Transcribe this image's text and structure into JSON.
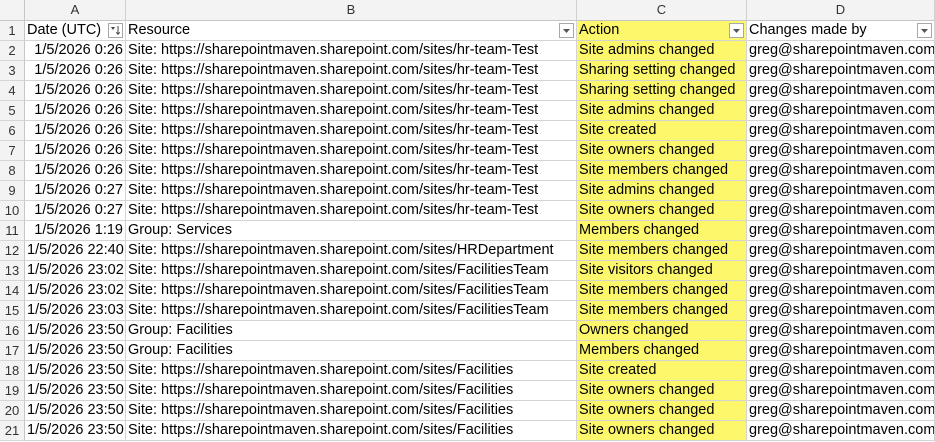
{
  "colors": {
    "highlight": "#fdf86b",
    "header_bg": "#f3f3f3",
    "grid": "#d4d4d4"
  },
  "columns": [
    "A",
    "B",
    "C",
    "D"
  ],
  "header": {
    "date": "Date (UTC)",
    "resource": "Resource",
    "action": "Action",
    "changed_by": "Changes made by"
  },
  "row_numbers": [
    "1",
    "2",
    "3",
    "4",
    "5",
    "6",
    "7",
    "8",
    "9",
    "10",
    "11",
    "12",
    "13",
    "14",
    "15",
    "16",
    "17",
    "18",
    "19",
    "20",
    "21"
  ],
  "rows": [
    {
      "date": "1/5/2026 0:26",
      "resource": "Site: https://sharepointmaven.sharepoint.com/sites/hr-team-Test",
      "action": "Site admins changed",
      "by": "greg@sharepointmaven.com"
    },
    {
      "date": "1/5/2026 0:26",
      "resource": "Site: https://sharepointmaven.sharepoint.com/sites/hr-team-Test",
      "action": "Sharing setting changed",
      "by": "greg@sharepointmaven.com"
    },
    {
      "date": "1/5/2026 0:26",
      "resource": "Site: https://sharepointmaven.sharepoint.com/sites/hr-team-Test",
      "action": "Sharing setting changed",
      "by": "greg@sharepointmaven.com"
    },
    {
      "date": "1/5/2026 0:26",
      "resource": "Site: https://sharepointmaven.sharepoint.com/sites/hr-team-Test",
      "action": "Site admins changed",
      "by": "greg@sharepointmaven.com"
    },
    {
      "date": "1/5/2026 0:26",
      "resource": "Site: https://sharepointmaven.sharepoint.com/sites/hr-team-Test",
      "action": "Site created",
      "by": "greg@sharepointmaven.com"
    },
    {
      "date": "1/5/2026 0:26",
      "resource": "Site: https://sharepointmaven.sharepoint.com/sites/hr-team-Test",
      "action": "Site owners changed",
      "by": "greg@sharepointmaven.com"
    },
    {
      "date": "1/5/2026 0:26",
      "resource": "Site: https://sharepointmaven.sharepoint.com/sites/hr-team-Test",
      "action": "Site members changed",
      "by": "greg@sharepointmaven.com"
    },
    {
      "date": "1/5/2026 0:27",
      "resource": "Site: https://sharepointmaven.sharepoint.com/sites/hr-team-Test",
      "action": "Site admins changed",
      "by": "greg@sharepointmaven.com"
    },
    {
      "date": "1/5/2026 0:27",
      "resource": "Site: https://sharepointmaven.sharepoint.com/sites/hr-team-Test",
      "action": "Site owners changed",
      "by": "greg@sharepointmaven.com"
    },
    {
      "date": "1/5/2026 1:19",
      "resource": "Group: Services",
      "action": "Members changed",
      "by": "greg@sharepointmaven.com"
    },
    {
      "date": "1/5/2026 22:40",
      "resource": "Site: https://sharepointmaven.sharepoint.com/sites/HRDepartment",
      "action": "Site members changed",
      "by": "greg@sharepointmaven.com"
    },
    {
      "date": "1/5/2026 23:02",
      "resource": "Site: https://sharepointmaven.sharepoint.com/sites/FacilitiesTeam",
      "action": "Site visitors changed",
      "by": "greg@sharepointmaven.com"
    },
    {
      "date": "1/5/2026 23:02",
      "resource": "Site: https://sharepointmaven.sharepoint.com/sites/FacilitiesTeam",
      "action": "Site members changed",
      "by": "greg@sharepointmaven.com"
    },
    {
      "date": "1/5/2026 23:03",
      "resource": "Site: https://sharepointmaven.sharepoint.com/sites/FacilitiesTeam",
      "action": "Site members changed",
      "by": "greg@sharepointmaven.com"
    },
    {
      "date": "1/5/2026 23:50",
      "resource": "Group: Facilities",
      "action": "Owners changed",
      "by": "greg@sharepointmaven.com"
    },
    {
      "date": "1/5/2026 23:50",
      "resource": "Group: Facilities",
      "action": "Members changed",
      "by": "greg@sharepointmaven.com"
    },
    {
      "date": "1/5/2026 23:50",
      "resource": "Site: https://sharepointmaven.sharepoint.com/sites/Facilities",
      "action": "Site created",
      "by": "greg@sharepointmaven.com"
    },
    {
      "date": "1/5/2026 23:50",
      "resource": "Site: https://sharepointmaven.sharepoint.com/sites/Facilities",
      "action": "Site owners changed",
      "by": "greg@sharepointmaven.com"
    },
    {
      "date": "1/5/2026 23:50",
      "resource": "Site: https://sharepointmaven.sharepoint.com/sites/Facilities",
      "action": "Site owners changed",
      "by": "greg@sharepointmaven.com"
    },
    {
      "date": "1/5/2026 23:50",
      "resource": "Site: https://sharepointmaven.sharepoint.com/sites/Facilities",
      "action": "Site owners changed",
      "by": "greg@sharepointmaven.com"
    }
  ]
}
